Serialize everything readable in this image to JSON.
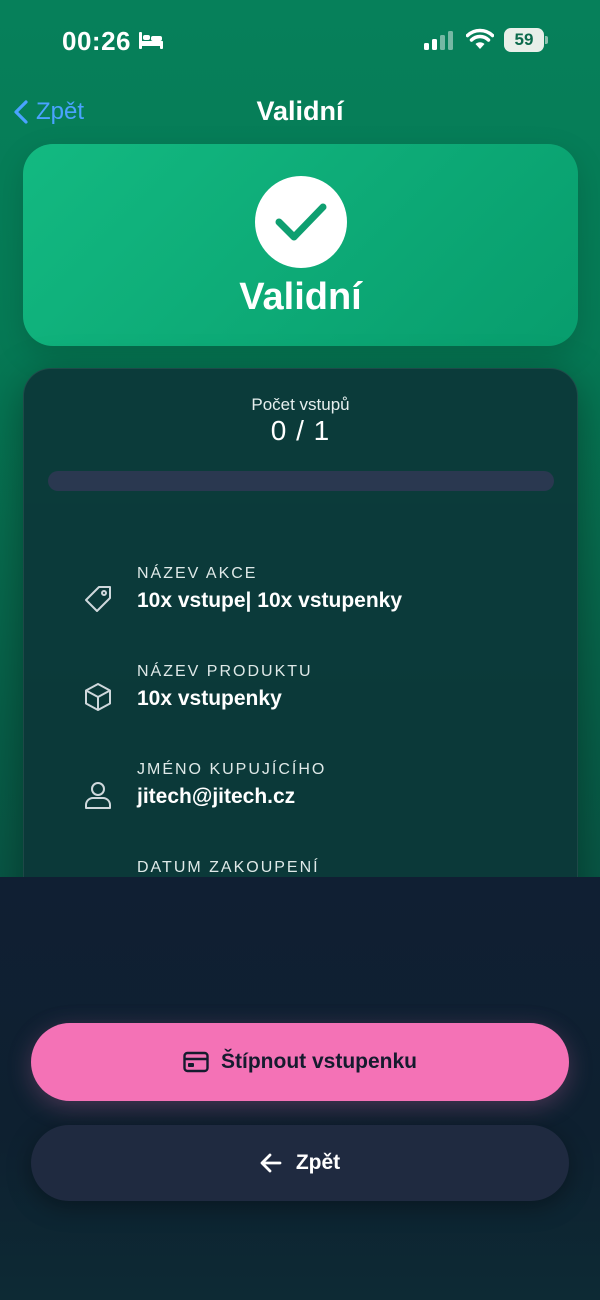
{
  "status_bar": {
    "time": "00:26",
    "battery": "59"
  },
  "nav": {
    "back_label": "Zpět",
    "title": "Validní"
  },
  "status_card": {
    "label": "Validní"
  },
  "entries": {
    "label": "Počet vstupů",
    "value": "0 / 1",
    "progress_fraction": 0
  },
  "details": [
    {
      "label": "NÁZEV AKCE",
      "value": "10x vstupe| 10x vstupenky",
      "icon": "tag-icon"
    },
    {
      "label": "NÁZEV PRODUKTU",
      "value": "10x vstupenky",
      "icon": "box-icon"
    },
    {
      "label": "JMÉNO KUPUJÍCÍHO",
      "value": "jitech@jitech.cz",
      "icon": "user-icon"
    },
    {
      "label": "DATUM ZAKOUPENÍ",
      "value": "",
      "icon": "calendar-icon"
    }
  ],
  "actions": {
    "primary_label": "Štípnout vstupenku",
    "secondary_label": "Zpět"
  },
  "colors": {
    "accent_green": "#10b981",
    "primary_pink": "#f472b6",
    "link_blue": "#4aa3ff"
  }
}
